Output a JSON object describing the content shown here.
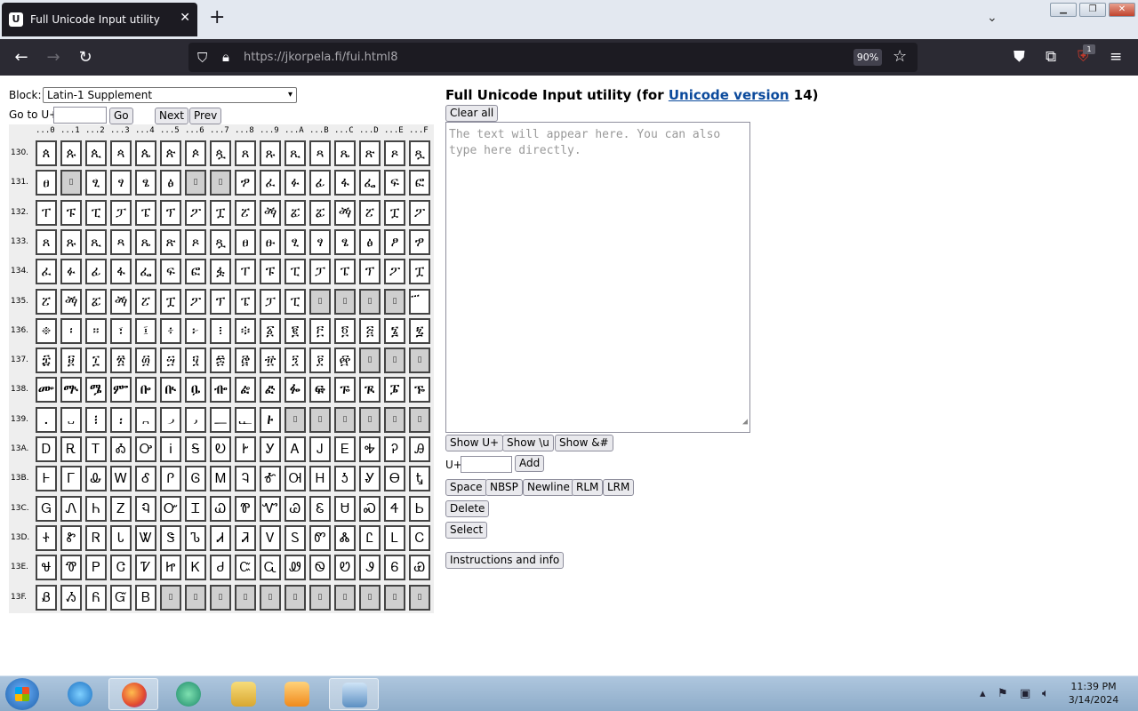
{
  "browser": {
    "tab_title": "Full Unicode Input utility",
    "tab_close": "✕",
    "new_tab": "+",
    "url_host": "https://jkorpela.fi",
    "url_path": "/fui.html8",
    "zoom": "90%",
    "ext_badge": "1"
  },
  "page": {
    "block_label": "Block:",
    "block_selected": "Latin-1 Supplement",
    "goto_label": "Go to U+",
    "go_btn": "Go",
    "next_btn": "Next",
    "prev_btn": "Prev",
    "title_prefix": "Full Unicode Input utility (for ",
    "title_link": "Unicode version",
    "title_suffix": " 14)",
    "clear_btn": "Clear all",
    "textarea_placeholder": "The text will appear here. You can also type here directly.",
    "show_uplus_btn": "Show U+",
    "show_u_btn": "Show \\u",
    "show_amp_btn": "Show &#",
    "uplus_label": "U+",
    "add_btn": "Add",
    "space_btn": "Space",
    "nbsp_btn": "NBSP",
    "newline_btn": "Newline",
    "rlm_btn": "RLM",
    "lrm_btn": "LRM",
    "delete_btn": "Delete",
    "select_btn": "Select",
    "instructions_btn": "Instructions and info"
  },
  "grid": {
    "col_headers": [
      "...0",
      "...1",
      "...2",
      "...3",
      "...4",
      "...5",
      "...6",
      "...7",
      "...8",
      "...9",
      "...A",
      "...B",
      "...C",
      "...D",
      "...E",
      "...F"
    ],
    "row_headers": [
      "130.",
      "131.",
      "132.",
      "133.",
      "134.",
      "135.",
      "136.",
      "137.",
      "138.",
      "139.",
      "13A.",
      "13B.",
      "13C.",
      "13D.",
      "13E.",
      "13F."
    ],
    "rows": [
      [
        "ጰ",
        "ጱ",
        "ጲ",
        "ጳ",
        "ጴ",
        "ጵ",
        "ጶ",
        "ጷ",
        "ጸ",
        "ጹ",
        "ጺ",
        "ጻ",
        "ጼ",
        "ጽ",
        "ጾ",
        "ጿ"
      ],
      [
        "ፀ",
        "#1311",
        "ፂ",
        "ፃ",
        "ፄ",
        "ፅ",
        "#1316",
        "#1317",
        "ፇ",
        "ፈ",
        "ፉ",
        "ፊ",
        "ፋ",
        "ፌ",
        "ፍ",
        "ፎ"
      ],
      [
        "ፐ",
        "ፑ",
        "ፒ",
        "ፓ",
        "ፔ",
        "ፕ",
        "ፖ",
        "ፗ",
        "ፘ",
        "ፙ",
        "ፚ",
        "ፚ",
        "ፙ",
        "ፘ",
        "ፗ",
        "ፖ"
      ],
      [
        "ጸ",
        "ጹ",
        "ጺ",
        "ጻ",
        "ጼ",
        "ጽ",
        "ጾ",
        "ጿ",
        "ፀ",
        "ፁ",
        "ፂ",
        "ፃ",
        "ፄ",
        "ፅ",
        "ፆ",
        "ፇ"
      ],
      [
        "ፈ",
        "ፉ",
        "ፊ",
        "ፋ",
        "ፌ",
        "ፍ",
        "ፎ",
        "ፏ",
        "ፐ",
        "ፑ",
        "ፒ",
        "ፓ",
        "ፔ",
        "ፕ",
        "ፖ",
        "ፗ"
      ],
      [
        "ፘ",
        "ፙ",
        "ፚ",
        "ፙ",
        "ፘ",
        "ፗ",
        "ፖ",
        "ፕ",
        "ፔ",
        "ፓ",
        "ፒ",
        "#135B",
        "#135C",
        "#135D",
        "#135E",
        "፝"
      ],
      [
        "፠",
        "፡",
        "።",
        "፣",
        "፤",
        "፥",
        "፦",
        "፧",
        "፨",
        "፩",
        "፪",
        "፫",
        "፬",
        "፭",
        "፮",
        "፯"
      ],
      [
        "፰",
        "፱",
        "፲",
        "፳",
        "፴",
        "፵",
        "፶",
        "፷",
        "፸",
        "፹",
        "፺",
        "፻",
        "፼",
        "#137D",
        "#137E",
        "#137F"
      ],
      [
        "ᎀ",
        "ᎁ",
        "ᎂ",
        "ᎃ",
        "ᎄ",
        "ᎅ",
        "ᎆ",
        "ᎇ",
        "ᎈ",
        "ᎉ",
        "ᎊ",
        "ᎋ",
        "ᎌ",
        "ᎍ",
        "ᎎ",
        "ᎏ"
      ],
      [
        "᎐",
        "᎑",
        "᎒",
        "᎓",
        "᎔",
        "᎕",
        "᎖",
        "᎗",
        "᎘",
        "᎙",
        "#139A",
        "#139B",
        "#139C",
        "#139D",
        "#139E",
        "#139F"
      ],
      [
        "Ꭰ",
        "Ꭱ",
        "Ꭲ",
        "Ꭳ",
        "Ꭴ",
        "Ꭵ",
        "Ꭶ",
        "Ꭷ",
        "Ꭸ",
        "Ꭹ",
        "Ꭺ",
        "Ꭻ",
        "Ꭼ",
        "Ꭽ",
        "Ꭾ",
        "Ꭿ"
      ],
      [
        "Ꮀ",
        "Ꮁ",
        "Ꮂ",
        "Ꮃ",
        "Ꮄ",
        "Ꮅ",
        "Ꮆ",
        "Ꮇ",
        "Ꮈ",
        "Ꮉ",
        "Ꮊ",
        "Ꮋ",
        "Ꮌ",
        "Ꮍ",
        "Ꮎ",
        "Ꮏ"
      ],
      [
        "Ꮐ",
        "Ꮑ",
        "Ꮒ",
        "Ꮓ",
        "Ꮔ",
        "Ꮕ",
        "Ꮖ",
        "Ꮗ",
        "Ꮘ",
        "Ꮙ",
        "Ꮚ",
        "Ꮛ",
        "Ꮜ",
        "Ꮝ",
        "Ꮞ",
        "Ꮟ"
      ],
      [
        "Ꮠ",
        "Ꮡ",
        "Ꮢ",
        "Ꮣ",
        "Ꮤ",
        "Ꮥ",
        "Ꮦ",
        "Ꮧ",
        "Ꮨ",
        "Ꮩ",
        "Ꮪ",
        "Ꮫ",
        "Ꮬ",
        "Ꮭ",
        "Ꮮ",
        "Ꮯ"
      ],
      [
        "Ꮰ",
        "Ꮱ",
        "Ꮲ",
        "Ꮳ",
        "Ꮴ",
        "Ꮵ",
        "Ꮶ",
        "Ꮷ",
        "Ꮸ",
        "Ꮹ",
        "Ꮺ",
        "Ꮻ",
        "Ꮼ",
        "Ꮽ",
        "Ꮾ",
        "Ꮿ"
      ],
      [
        "Ᏸ",
        "Ᏹ",
        "Ᏺ",
        "Ᏻ",
        "Ᏼ",
        "#13F5",
        "#13F6",
        "#13F7",
        "#13F8",
        "#13F9",
        "#13FA",
        "#13FB",
        "#13FC",
        "#13FD",
        "#13FE",
        "#13FF"
      ]
    ]
  },
  "taskbar": {
    "time": "11:39 PM",
    "date": "3/14/2024"
  }
}
